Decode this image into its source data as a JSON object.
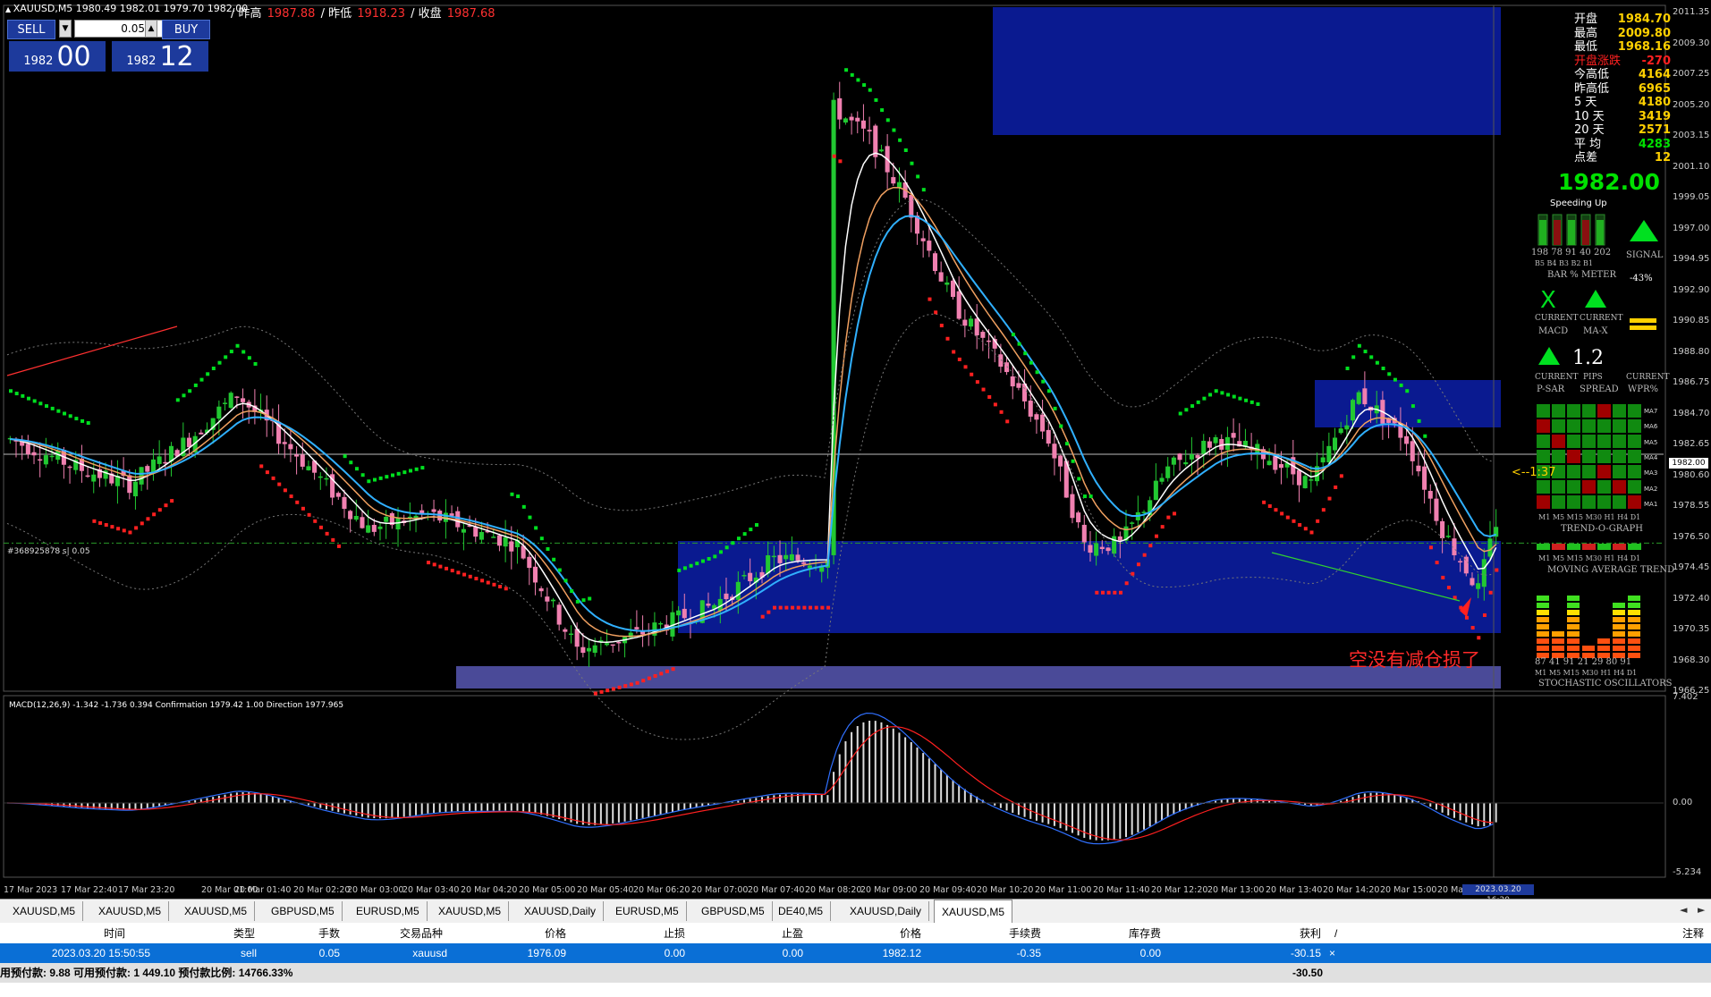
{
  "symbol_line": "XAUUSD,M5  1980.49 1982.01 1979.70 1982.00",
  "prev_stats": {
    "high_label": "/ 昨高",
    "high_value": "1987.88",
    "low_label": "/ 昨低",
    "low_value": "1918.23",
    "close_label": "/ 收盘",
    "close_value": "1987.68"
  },
  "trade_panel": {
    "sell_label": "SELL",
    "buy_label": "BUY",
    "lot": "0.05",
    "sell_price_small": "1982",
    "sell_price_big": "00",
    "buy_price_small": "1982",
    "buy_price_big": "12"
  },
  "info_panel": {
    "rows": [
      {
        "label": "开盘",
        "value": "1984.70",
        "color": "#ffd000"
      },
      {
        "label": "最高",
        "value": "2009.80",
        "color": "#ffd000"
      },
      {
        "label": "最低",
        "value": "1968.16",
        "color": "#ffd000"
      },
      {
        "label": "开盘涨跌",
        "value": "-270",
        "color": "#ff2020"
      },
      {
        "label": "今高低",
        "value": "4164",
        "color": "#ffd000"
      },
      {
        "label": "昨高低",
        "value": "6965",
        "color": "#ffd000"
      },
      {
        "label": "5   天",
        "value": "4180",
        "color": "#ffd000"
      },
      {
        "label": "10  天",
        "value": "3419",
        "color": "#ffd000"
      },
      {
        "label": "20  天",
        "value": "2571",
        "color": "#ffd000"
      },
      {
        "label": "平  均",
        "value": "4283",
        "color": "#00e000"
      },
      {
        "label": "点差",
        "value": "12",
        "color": "#ffd000"
      }
    ],
    "current_price": "1982.00"
  },
  "indicator_panel": {
    "speeding_up": "Speeding Up",
    "bar_values": "198 78 91 40 202",
    "bar_labels": "B5 B4 B3 B2 B1",
    "signal": "SIGNAL",
    "bar_meter": "BAR % METER",
    "pct": "-43%",
    "current_1": "CURRENT",
    "macd": "MACD",
    "current_2": "CURRENT",
    "max": "MA-X",
    "current_3": "CURRENT",
    "psar": "P-SAR",
    "pips": "PIPS",
    "spread_value": "1.2",
    "spread": "SPREAD",
    "current_4": "CURRENT",
    "wpr": "WPR%",
    "trend_o_graph": "TREND-O-GRAPH",
    "tf_row": "M1 M5 M15 M30 H1 H4 D1",
    "ma_trend": "MOVING AVERAGE TREND",
    "stoch_values": "87 41 91 21 29 80 91",
    "stoch_tf": "M1 M5 M15 M30 H1 H4 D1",
    "stoch": "STOCHASTIC OSCILLATORS",
    "ma_labels": [
      "MA7",
      "MA6",
      "MA5",
      "MA4",
      "MA3",
      "MA2",
      "MA1"
    ],
    "timer": "<--1:37"
  },
  "price_axis": [
    "2011.35",
    "2009.30",
    "2007.25",
    "2005.20",
    "2003.15",
    "2001.10",
    "1999.05",
    "1997.00",
    "1994.95",
    "1992.90",
    "1990.85",
    "1988.80",
    "1986.75",
    "1984.70",
    "1982.65",
    "1980.60",
    "1978.55",
    "1976.50",
    "1974.45",
    "1972.40",
    "1970.35",
    "1968.30",
    "1966.25"
  ],
  "current_price_tag": "1982.00",
  "macd_axis": [
    "7.402",
    "0.00",
    "-5.234"
  ],
  "macd_label": "MACD(12,26,9) -1.342 -1.736 0.394   Confirmation 1979.42 1.00   Direction 1977.965",
  "order_label": "#368925878 s| 0.05",
  "annotation": "空没有减仓损了",
  "time_axis": [
    "17 Mar 2023",
    "17 Mar 22:40",
    "17 Mar 23:20",
    "20 Mar 01:00",
    "20 Mar 01:40",
    "20 Mar 02:20",
    "20 Mar 03:00",
    "20 Mar 03:40",
    "20 Mar 04:20",
    "20 Mar 05:00",
    "20 Mar 05:40",
    "20 Mar 06:20",
    "20 Mar 07:00",
    "20 Mar 07:40",
    "20 Mar 08:20",
    "20 Mar 09:00",
    "20 Mar 09:40",
    "20 Mar 10:20",
    "20 Mar 11:00",
    "20 Mar 11:40",
    "20 Mar 12:20",
    "20 Mar 13:00",
    "20 Mar 13:40",
    "20 Mar 14:20",
    "20 Mar 15:00",
    "20 Ma"
  ],
  "time_cursor": "2023.03.20 16:20",
  "tabs": [
    "XAUUSD,M5",
    "XAUUSD,M5",
    "XAUUSD,M5",
    "GBPUSD,M5",
    "EURUSD,M5",
    "XAUUSD,M5",
    "XAUUSD,Daily",
    "EURUSD,M5",
    "GBPUSD,M5",
    "DE40,M5",
    "XAUUSD,Daily",
    "XAUUSD,M5"
  ],
  "table": {
    "headers": [
      "时间",
      "类型",
      "手数",
      "交易品种",
      "价格",
      "止损",
      "止盈",
      "价格",
      "手续费",
      "库存费",
      "获利",
      "/",
      "注释"
    ],
    "row": {
      "time": "2023.03.20 15:50:55",
      "type": "sell",
      "lots": "0.05",
      "symbol": "xauusd",
      "open_price": "1976.09",
      "sl": "0.00",
      "tp": "0.00",
      "price": "1982.12",
      "commission": "-0.35",
      "swap": "0.00",
      "profit": "-30.15",
      "close": "×"
    },
    "summary": "用预付款: 9.88  可用预付款: 1 449.10  预付款比例: 14766.33%",
    "summary_profit": "-30.50"
  },
  "colors": {
    "bull": "#22c832",
    "bear": "#f080b0",
    "zone": "#0a1a90",
    "sar_green": "#00e020",
    "sar_red": "#ff2020"
  }
}
